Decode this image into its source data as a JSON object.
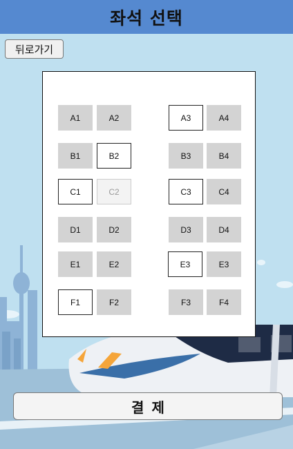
{
  "header": {
    "title": "좌석 선택"
  },
  "back_button": {
    "label": "뒤로가기"
  },
  "pay_button": {
    "label": "결  제"
  },
  "seats": [
    {
      "id": "A1",
      "label": "A1",
      "status": "taken"
    },
    {
      "id": "A2",
      "label": "A2",
      "status": "taken"
    },
    {
      "id": "A3",
      "label": "A3",
      "status": "available"
    },
    {
      "id": "A4",
      "label": "A4",
      "status": "taken"
    },
    {
      "id": "B1",
      "label": "B1",
      "status": "taken"
    },
    {
      "id": "B2",
      "label": "B2",
      "status": "available"
    },
    {
      "id": "B3",
      "label": "B3",
      "status": "taken"
    },
    {
      "id": "B4",
      "label": "B4",
      "status": "taken"
    },
    {
      "id": "C1",
      "label": "C1",
      "status": "available"
    },
    {
      "id": "C2",
      "label": "C2",
      "status": "disabled"
    },
    {
      "id": "C3",
      "label": "C3",
      "status": "available"
    },
    {
      "id": "C4",
      "label": "C4",
      "status": "taken"
    },
    {
      "id": "D1",
      "label": "D1",
      "status": "taken"
    },
    {
      "id": "D2",
      "label": "D2",
      "status": "taken"
    },
    {
      "id": "D3",
      "label": "D3",
      "status": "taken"
    },
    {
      "id": "D4",
      "label": "D4",
      "status": "taken"
    },
    {
      "id": "E1",
      "label": "E1",
      "status": "taken"
    },
    {
      "id": "E2",
      "label": "E2",
      "status": "taken"
    },
    {
      "id": "E3a",
      "label": "E3",
      "status": "available"
    },
    {
      "id": "E3b",
      "label": "E3",
      "status": "taken"
    },
    {
      "id": "F1",
      "label": "F1",
      "status": "available"
    },
    {
      "id": "F2",
      "label": "F2",
      "status": "taken"
    },
    {
      "id": "F3",
      "label": "F3",
      "status": "taken"
    },
    {
      "id": "F4",
      "label": "F4",
      "status": "taken"
    }
  ],
  "colors": {
    "header": "#5589d0",
    "seat_taken": "#d3d3d3",
    "seat_available": "#ffffff",
    "sky": "#bfe0f0"
  }
}
